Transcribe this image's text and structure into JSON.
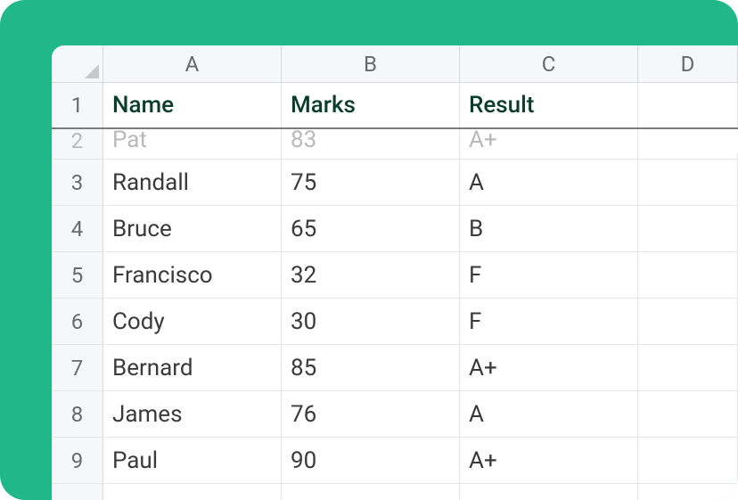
{
  "columns": [
    "A",
    "B",
    "C",
    "D"
  ],
  "header_row": {
    "num": "1",
    "name": "Name",
    "marks": "Marks",
    "result": "Result"
  },
  "partial_scrolled_row": {
    "num": "2",
    "name": "Pat",
    "marks": "83",
    "result": "A+"
  },
  "rows": [
    {
      "num": "3",
      "name": "Randall",
      "marks": "75",
      "result": "A"
    },
    {
      "num": "4",
      "name": "Bruce",
      "marks": "65",
      "result": "B"
    },
    {
      "num": "5",
      "name": "Francisco",
      "marks": "32",
      "result": "F"
    },
    {
      "num": "6",
      "name": "Cody",
      "marks": "30",
      "result": "F"
    },
    {
      "num": "7",
      "name": "Bernard",
      "marks": "85",
      "result": "A+"
    },
    {
      "num": "8",
      "name": "James",
      "marks": "76",
      "result": "A"
    },
    {
      "num": "9",
      "name": "Paul",
      "marks": "90",
      "result": "A+"
    }
  ]
}
